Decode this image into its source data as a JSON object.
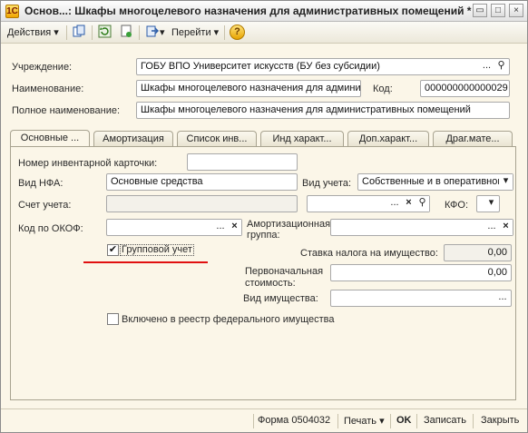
{
  "window": {
    "title": "Основ...: Шкафы многоцелевого назначения для административных помещений *",
    "app_icon": "1С",
    "app_icon_name": "app-logo-icon",
    "buttons": {
      "restore": "▭",
      "minimize": "_",
      "maximize": "□",
      "close": "×"
    }
  },
  "toolbar": {
    "actions_label": "Действия",
    "go_label": "Перейти",
    "dropdown_glyph": "▾",
    "help_glyph": "?",
    "icons": [
      "copy-icon",
      "refresh-icon",
      "structure-icon",
      "enter-based-icon",
      "help-icon"
    ]
  },
  "header": {
    "institution_label": "Учреждение:",
    "institution_value": "ГОБУ ВПО Университет искусств (БУ без субсидии)",
    "name_label": "Наименование:",
    "name_value": "Шкафы многоцелевого назначения для администр",
    "code_label": "Код:",
    "code_value": "000000000000029",
    "full_name_label": "Полное наименование:",
    "full_name_value": "Шкафы многоцелевого назначения для административных помещений"
  },
  "tabs": [
    {
      "label": "Основные ..."
    },
    {
      "label": "Амортизация"
    },
    {
      "label": "Список инв..."
    },
    {
      "label": "Инд характ..."
    },
    {
      "label": "Доп.характ..."
    },
    {
      "label": "Драг.мате..."
    }
  ],
  "main": {
    "inventory_card_label": "Номер инвентарной карточки:",
    "inventory_card_value": "",
    "nfa_type_label": "Вид НФА:",
    "nfa_type_value": "Основные средства",
    "accounting_type_label": "Вид учета:",
    "accounting_type_value": "Собственные и в оперативном",
    "account_label": "Счет учета:",
    "account_value": "",
    "kfo_label": "КФО:",
    "kfo_value": "",
    "okof_label": "Код по ОКОФ:",
    "okof_value": "",
    "depreciation_group_label": "Амортизационная группа:",
    "depreciation_group_value": "",
    "group_accounting_label": "Групповой учет",
    "group_accounting_checked": true,
    "property_tax_rate_label": "Ставка налога на имущество:",
    "property_tax_rate_value": "0,00",
    "initial_cost_label": "Первоначальная стоимость:",
    "initial_cost_value": "0,00",
    "property_type_label": "Вид имущества:",
    "property_type_value": "",
    "federal_registry_label": "Включено в реестр федерального имущества",
    "federal_registry_checked": false
  },
  "glyphs": {
    "ellipsis": "...",
    "clear": "×",
    "search": "⚲",
    "dropdown": "▾",
    "check": "✔"
  },
  "footer": {
    "form_label": "Форма 0504032",
    "print_label": "Печать",
    "ok_label": "OK",
    "save_label": "Записать",
    "close_label": "Закрыть"
  },
  "colors": {
    "annotation_underline": "#e01010",
    "window_bg": "#fbf6e8"
  }
}
